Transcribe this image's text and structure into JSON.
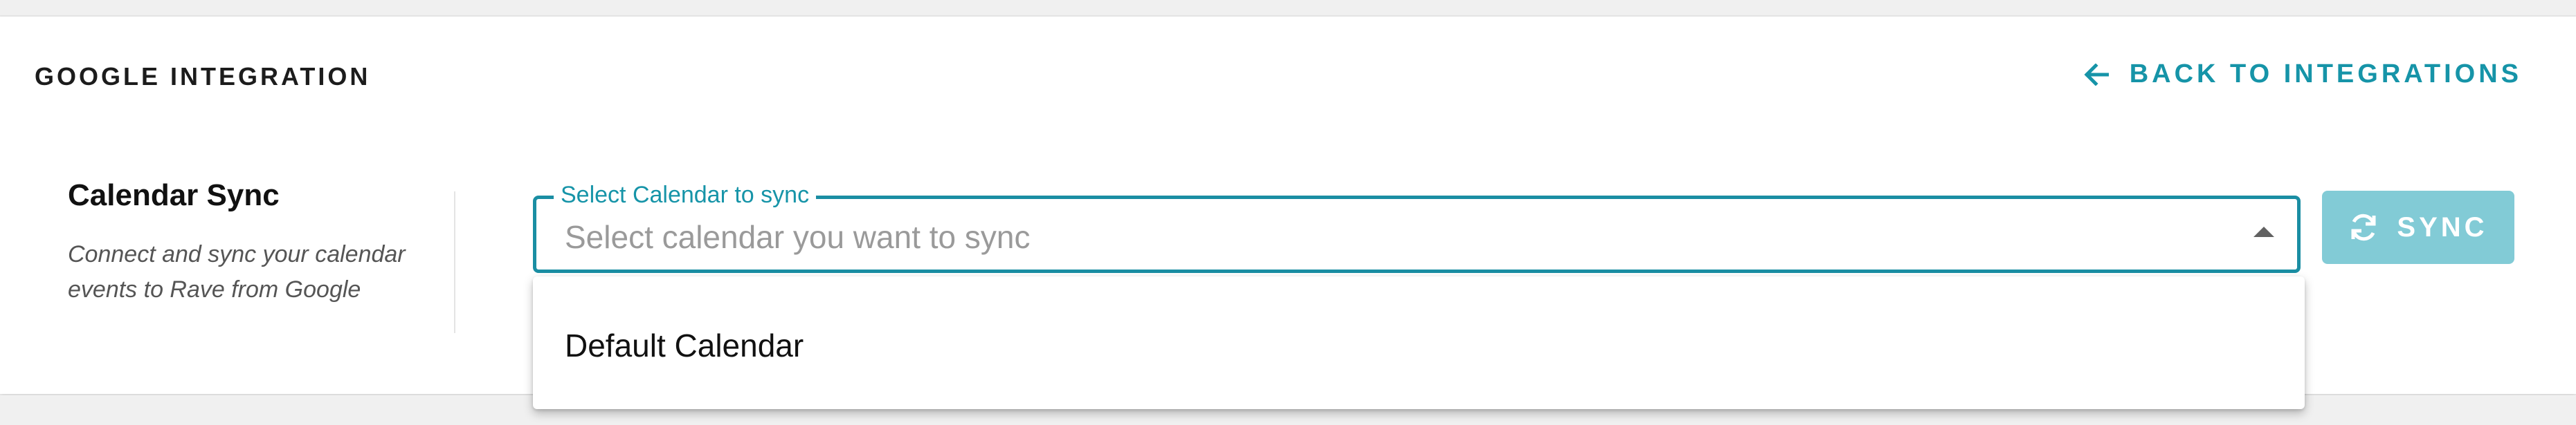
{
  "header": {
    "title": "GOOGLE INTEGRATION",
    "back_link_label": "BACK TO INTEGRATIONS"
  },
  "calendar_sync": {
    "title": "Calendar Sync",
    "description": "Connect and sync your calendar events to Rave from Google"
  },
  "calendar_select": {
    "label": "Select Calendar to sync",
    "placeholder": "Select calendar you want to sync",
    "options": [
      "Default Calendar"
    ],
    "expanded": true
  },
  "sync_button": {
    "label": "SYNC",
    "icon": "sync-icon",
    "disabled": true
  },
  "colors": {
    "accent": "#1694a8",
    "button_disabled_bg": "#82cbd6",
    "border_accent": "#1a8ea3"
  }
}
